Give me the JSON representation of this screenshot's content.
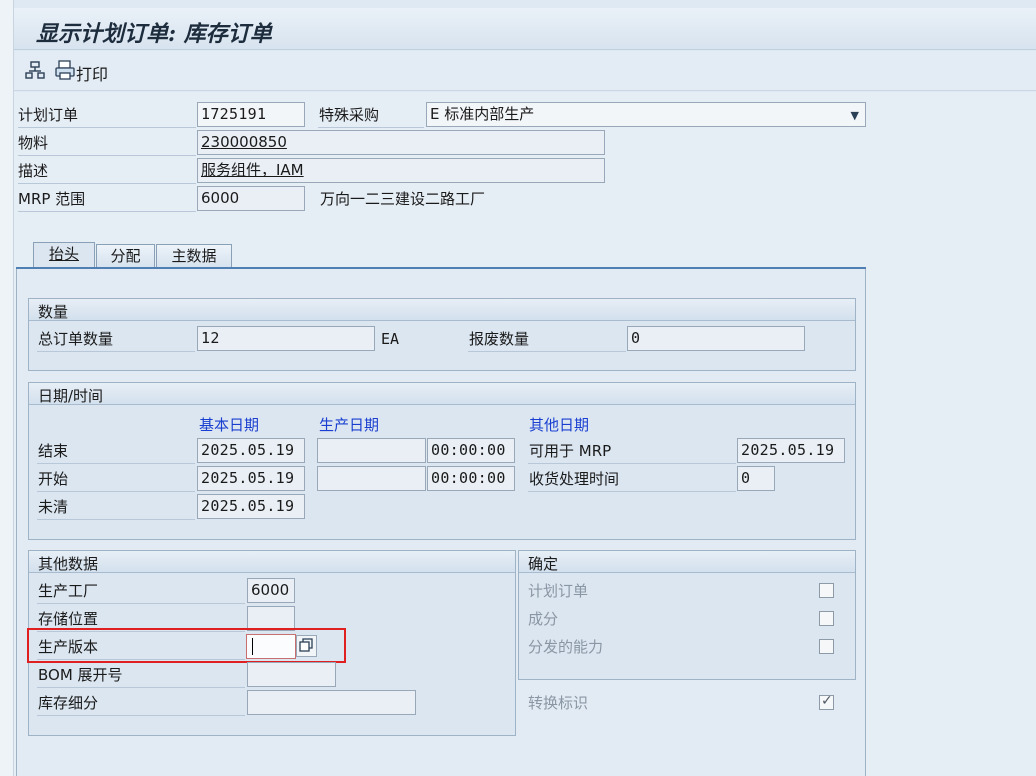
{
  "window": {
    "title": "显示计划订单: 库存订单"
  },
  "toolbar": {
    "print_label": "打印"
  },
  "header": {
    "planned_order_label": "计划订单",
    "planned_order_value": "1725191",
    "special_procurement_label": "特殊采购",
    "special_procurement_value": "E 标准内部生产",
    "material_label": "物料",
    "material_value": "230000850",
    "description_label": "描述",
    "description_value": "服务组件，IAM",
    "mrp_area_label": "MRP 范围",
    "mrp_area_value": "6000",
    "mrp_area_text": "万向一二三建设二路工厂"
  },
  "tabs": [
    {
      "label": "抬头"
    },
    {
      "label": "分配"
    },
    {
      "label": "主数据"
    }
  ],
  "quantity": {
    "title": "数量",
    "total_label": "总订单数量",
    "total_value": "12",
    "unit": "EA",
    "scrap_label": "报废数量",
    "scrap_value": "0"
  },
  "dates": {
    "title": "日期/时间",
    "col_basic": "基本日期",
    "col_production": "生产日期",
    "col_other": "其他日期",
    "end_label": "结束",
    "end_basic": "2025.05.19",
    "end_prod": "",
    "end_time": "00:00:00",
    "start_label": "开始",
    "start_basic": "2025.05.19",
    "start_prod": "",
    "start_time": "00:00:00",
    "open_label": "未清",
    "open_basic": "2025.05.19",
    "mrp_avail_label": "可用于 MRP",
    "mrp_avail_value": "2025.05.19",
    "gr_time_label": "收货处理时间",
    "gr_time_value": "0"
  },
  "other": {
    "title": "其他数据",
    "plant_label": "生产工厂",
    "plant_value": "6000",
    "storage_label": "存储位置",
    "storage_value": "",
    "version_label": "生产版本",
    "version_value": "",
    "bom_label": "BOM 展开号",
    "bom_value": "",
    "stock_label": "库存细分",
    "stock_value": ""
  },
  "firm": {
    "title": "确定",
    "planned_order_label": "计划订单",
    "planned_order_checked": false,
    "component_label": "成分",
    "component_checked": false,
    "capacity_label": "分发的能力",
    "capacity_checked": false
  },
  "conversion_label": "转换标识",
  "conversion_checked": true,
  "colors": {
    "highlight": "#e02020",
    "column_header": "#1a3fd0"
  }
}
